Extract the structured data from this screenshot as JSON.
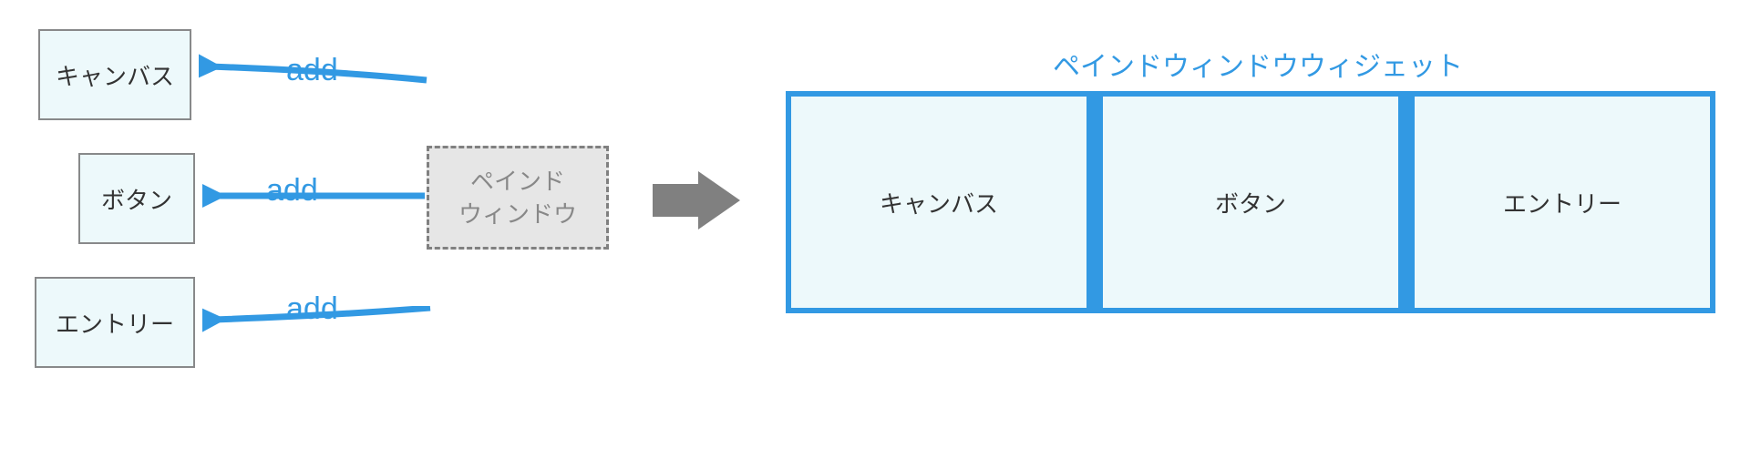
{
  "widgets": {
    "canvas": "キャンバス",
    "button": "ボタン",
    "entry": "エントリー"
  },
  "source": {
    "line1": "ペインド",
    "line2": "ウィンドウ"
  },
  "addLabel": "add",
  "paned": {
    "title": "ペインドウィンドウウィジェット",
    "children": {
      "canvas": "キャンバス",
      "button": "ボタン",
      "entry": "エントリー"
    }
  }
}
